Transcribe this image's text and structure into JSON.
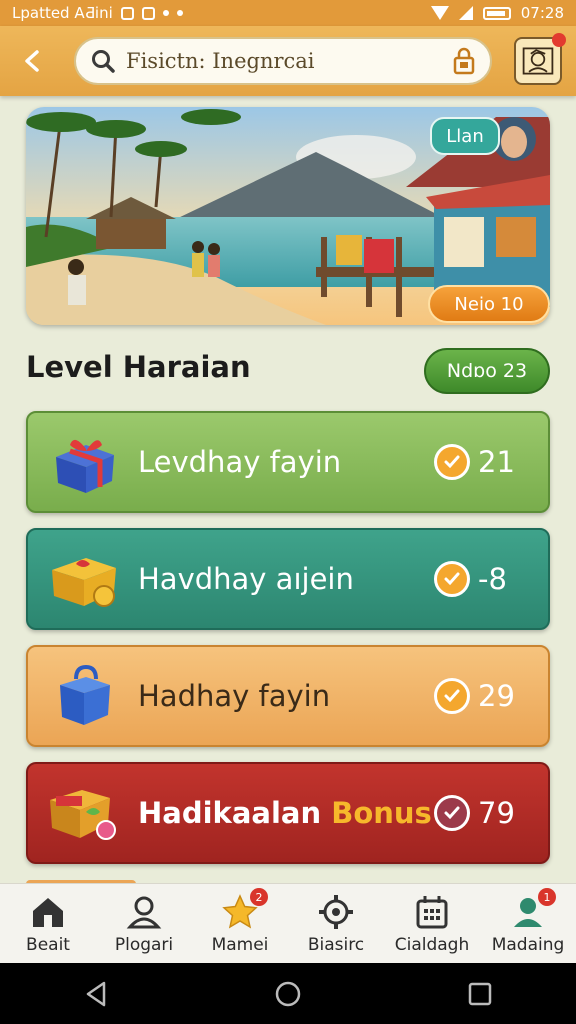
{
  "status_bar": {
    "left_text": "Lpatted AƋini",
    "time": "07:28"
  },
  "header": {
    "search_text": "Fisictn: Inegnrcai"
  },
  "hero": {
    "pill_label": "Llan",
    "badge_label": "Neio 10"
  },
  "level": {
    "title": "Level Haraian",
    "pill_label": "Ndɒo 23"
  },
  "cards": [
    {
      "label": "Levdhay fayin",
      "value": "21"
    },
    {
      "label": "Havdhay aıjein",
      "value": "-8"
    },
    {
      "label": "Hadhay fayin",
      "value": "29"
    },
    {
      "label": "Hadikaalan",
      "label_accent": "Bonus",
      "value": "79"
    }
  ],
  "bottom_nav": [
    {
      "label": "Beait",
      "icon": "home-icon"
    },
    {
      "label": "Plogari",
      "icon": "user-icon"
    },
    {
      "label": "Mamei",
      "icon": "star-icon",
      "badge": "2"
    },
    {
      "label": "Biasirc",
      "icon": "gear-icon"
    },
    {
      "label": "Cialdagh",
      "icon": "calendar-icon"
    },
    {
      "label": "Madaing",
      "icon": "profile-icon",
      "badge": "1"
    }
  ],
  "colors": {
    "header": "#e4a443",
    "card_green": "#79ad4c",
    "card_teal": "#2c8670",
    "card_orange": "#eba555",
    "card_red": "#a02420",
    "bonus": "#f7b82b"
  }
}
